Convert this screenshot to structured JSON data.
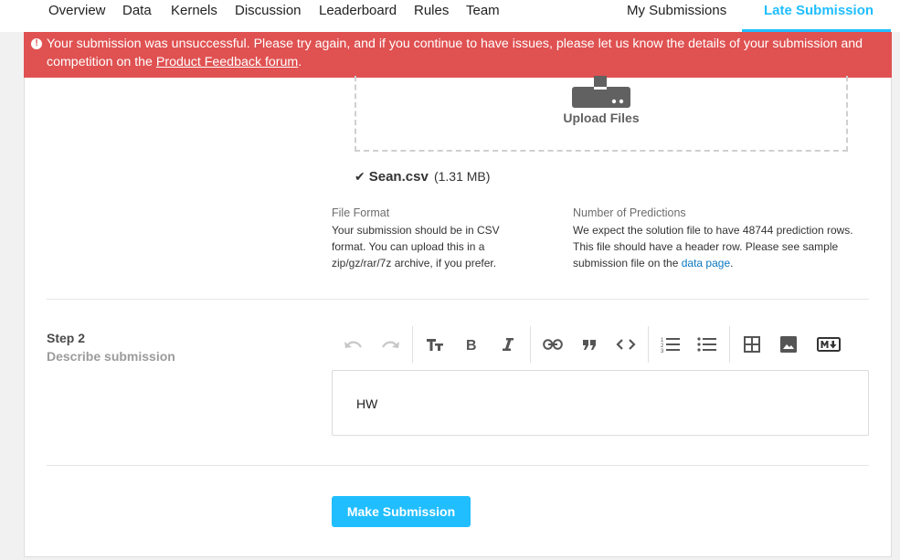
{
  "nav": {
    "tabs": [
      "Overview",
      "Data",
      "Kernels",
      "Discussion",
      "Leaderboard",
      "Rules",
      "Team"
    ],
    "my_submissions": "My Submissions",
    "late_submission": "Late Submission"
  },
  "error": {
    "icon": "exclamation-circle-icon",
    "message": "Your submission was unsuccessful. Please try again, and if you continue to have issues, please let us know the details of your submission and competition on the ",
    "link": "Product Feedback forum",
    "suffix": "."
  },
  "upload": {
    "label": "Upload Files",
    "icon": "upload-drive-icon"
  },
  "file": {
    "check_icon": "checkmark-icon",
    "name": "Sean.csv",
    "size": "(1.31 MB)"
  },
  "file_format": {
    "title": "File Format",
    "body": "Your submission should be in CSV format. You can upload this in a zip/gz/rar/7z archive, if you prefer."
  },
  "predictions": {
    "title": "Number of Predictions",
    "body": "We expect the solution file to have 48744 prediction rows. This file should have a header row. Please see sample submission file on the ",
    "link": "data page",
    "suffix": "."
  },
  "step2": {
    "number": "Step 2",
    "description": "Describe submission"
  },
  "toolbar": {
    "icons": [
      "undo-icon",
      "redo-icon",
      "text-size-icon",
      "bold-icon",
      "italic-icon",
      "link-icon",
      "quote-icon",
      "code-icon",
      "ordered-list-icon",
      "bullet-list-icon",
      "table-icon",
      "image-icon",
      "markdown-icon"
    ]
  },
  "editor": {
    "value": "HW"
  },
  "submit": {
    "label": "Make Submission"
  },
  "colors": {
    "accent": "#20beff",
    "error": "#e05151",
    "link": "#0a78c2"
  }
}
